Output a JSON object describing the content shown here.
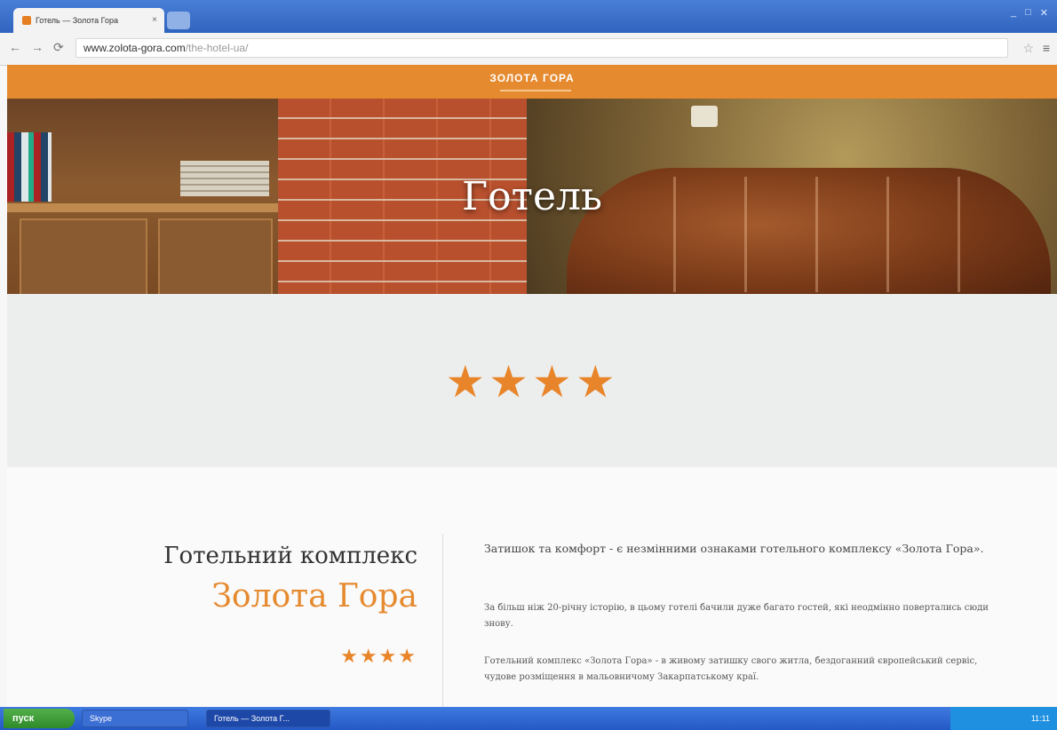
{
  "browser": {
    "tab_title": "Готель — Золота Гора",
    "tab_close": "×",
    "url_host": "www.zolota-gora.com",
    "url_path": "/the-hotel-ua/",
    "nav_back": "←",
    "nav_forward": "→",
    "nav_reload": "⟳",
    "bookmark_star": "☆",
    "menu_glyph": "≡",
    "win_min": "_",
    "win_max": "□",
    "win_close": "✕"
  },
  "site": {
    "logo": "ЗОЛОТА ГОРА",
    "hero_title": "Готель",
    "rating_stars": "★★★★",
    "rating_count": 4
  },
  "intro": {
    "kind": "Готельний комплекс",
    "name": "Золота Гора",
    "stars": "★★★★",
    "p1": "Затишок та комфорт - є незмінними ознаками готельного комплексу «Золота Гора».",
    "p2": "За більш ніж 20-річну історію, в цьому готелі бачили дуже багато гостей, які неодмінно повертались сюди знову.",
    "p3": "Готельний комплекс «Золота Гора» - в живому затишку свого житла, бездоганний європейський сервіс, чудове розміщення в мальовничому Закарпатському краї."
  },
  "taskbar": {
    "start": "пуск",
    "task1": "Skype",
    "task2": "Готель — Золота Г...",
    "clock": "11:11"
  }
}
